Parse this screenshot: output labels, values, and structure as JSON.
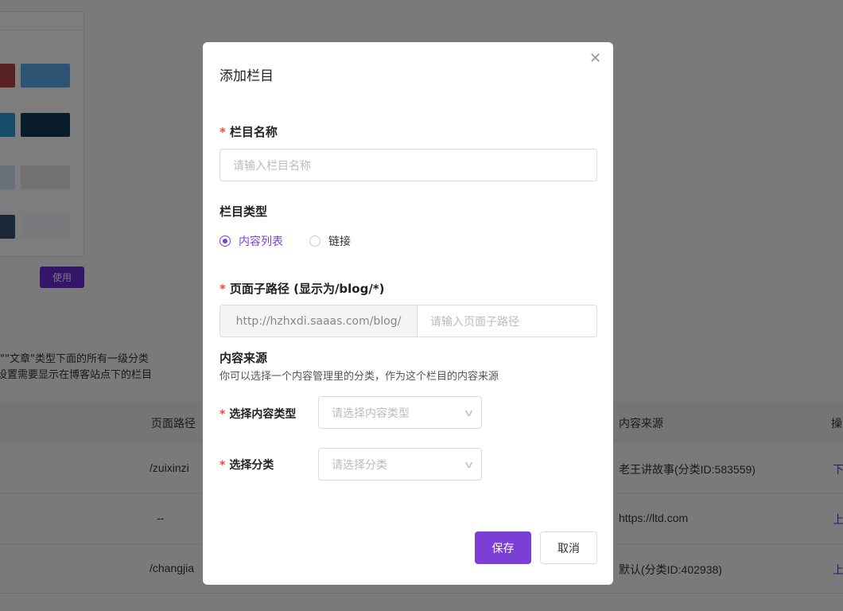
{
  "background": {
    "use_button": "使用",
    "hint_line1": "\"\"文章\"类型下面的所有一级分类",
    "hint_line2": "设置需要显示在博客站点下的栏目",
    "table": {
      "headers": [
        "页面路径",
        "内容来源",
        "操"
      ],
      "rows": [
        {
          "path": "/zuixinzi",
          "source": "老王讲故事(分类ID:583559)",
          "op": "下"
        },
        {
          "path": "--",
          "source": "https://ltd.com",
          "op": "上"
        },
        {
          "path": "/changjia",
          "source": "默认(分类ID:402938)",
          "op": "上"
        }
      ]
    }
  },
  "modal": {
    "title": "添加栏目",
    "close_icon": "close-icon",
    "name_label": "栏目名称",
    "name_placeholder": "请输入栏目名称",
    "type_label": "栏目类型",
    "type_options": [
      {
        "label": "内容列表",
        "selected": true
      },
      {
        "label": "链接",
        "selected": false
      }
    ],
    "path_label": "页面子路径 (显示为/blog/*)",
    "path_prefix": "http://hzhxdi.saaas.com/blog/",
    "path_placeholder": "请输入页面子路径",
    "source_title": "内容来源",
    "source_desc": "你可以选择一个内容管理里的分类，作为这个栏目的内容来源",
    "content_type_label": "选择内容类型",
    "content_type_placeholder": "请选择内容类型",
    "category_label": "选择分类",
    "category_placeholder": "请选择分类",
    "required_mark": "*",
    "save": "保存",
    "cancel": "取消"
  },
  "colors": {
    "accent": "#7b3fd6",
    "required": "#f04848"
  }
}
